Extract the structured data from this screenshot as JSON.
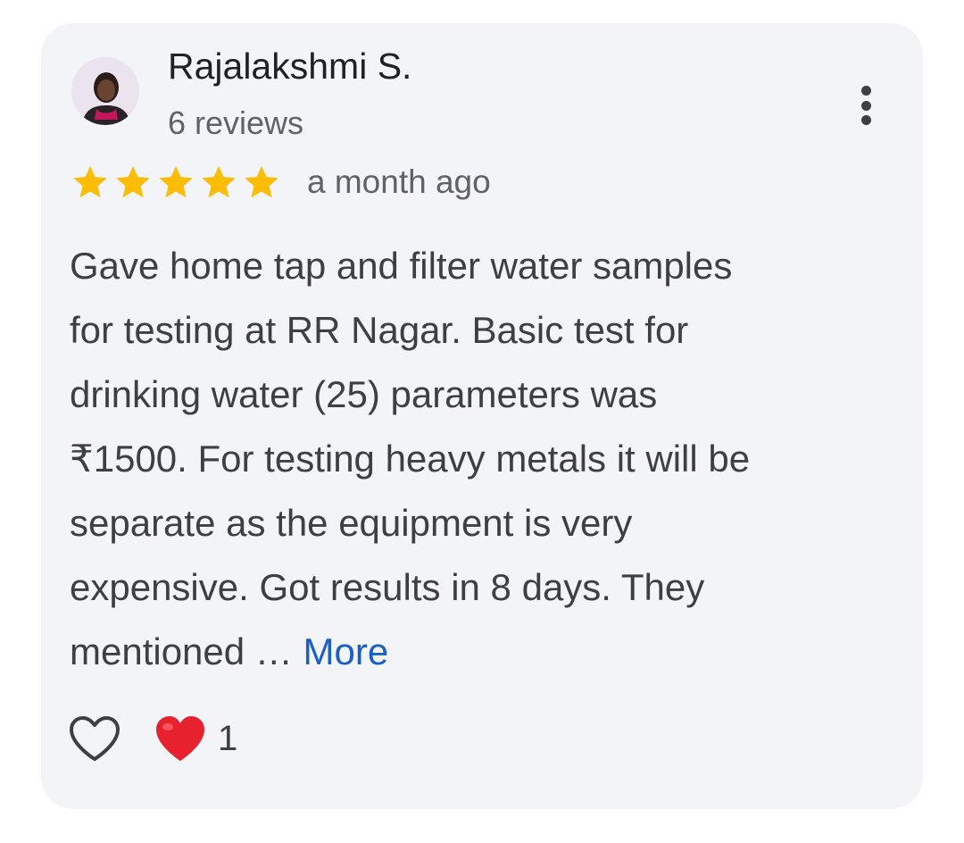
{
  "review": {
    "author_name": "Rajalakshmi S.",
    "review_count": "6 reviews",
    "rating": 5,
    "rating_max": 5,
    "time_ago": "a month ago",
    "text_lines": [
      "Gave home tap and filter water samples",
      "for testing at RR Nagar. Basic test for",
      "drinking water (25) parameters was",
      "₹1500. For testing heavy metals it will be",
      "separate as the equipment is very",
      "expensive. Got results in 8 days. They",
      "mentioned …"
    ],
    "more_label": "More",
    "reaction_count": "1"
  },
  "icons": {
    "menu": "more-vert-icon",
    "star": "star-filled-icon",
    "like": "heart-outline-icon",
    "reaction": "red-heart-icon"
  },
  "colors": {
    "card_background": "#f3f4f7",
    "star": "#fbbc04",
    "link": "#1a5fc7",
    "reaction_heart": "#e8212e"
  }
}
